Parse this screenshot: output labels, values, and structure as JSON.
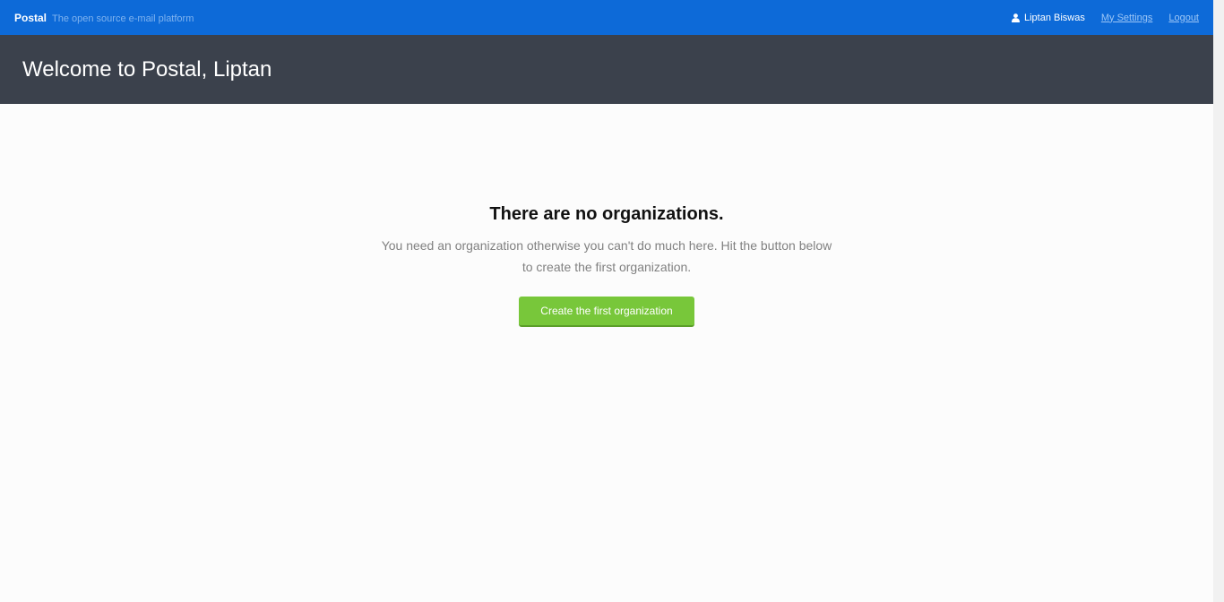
{
  "topbar": {
    "brand_name": "Postal",
    "brand_tagline": "The open source e-mail platform",
    "user_name": "Liptan Biswas",
    "my_settings_label": "My Settings",
    "logout_label": "Logout"
  },
  "header": {
    "title": "Welcome to Postal, Liptan"
  },
  "empty_state": {
    "heading": "There are no organizations.",
    "text": "You need an organization otherwise you can't do much here. Hit the button below to create the first organization.",
    "button_label": "Create the first organization"
  },
  "icons": {
    "user": "user-icon"
  },
  "colors": {
    "topbar": "#0d6ad8",
    "header": "#3b414c",
    "button": "#78c73a"
  }
}
